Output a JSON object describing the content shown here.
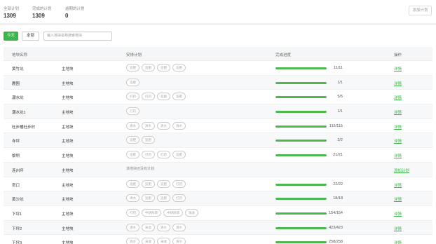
{
  "stats": [
    {
      "label": "全部计划",
      "value": "1309"
    },
    {
      "label": "完成的计划",
      "value": "1309"
    },
    {
      "label": "逾期的计划",
      "value": "0"
    }
  ],
  "plan_button": "添加计划",
  "toolbar": {
    "today": "今天",
    "all": "全部",
    "search_placeholder": "输入地块名称搜索地块"
  },
  "columns": {
    "name": "地块名称",
    "plan": "安排计划",
    "progress": "完成进度",
    "op": "操作"
  },
  "rows": [
    {
      "name": "黄竹坑",
      "type": "主地块",
      "tags": [
        "追肥",
        "追肥",
        "追肥",
        "追肥"
      ],
      "note": "",
      "progress": 1.0,
      "count": "11/11",
      "op": "详情"
    },
    {
      "name": "鹿囿",
      "type": "主地块",
      "tags": [
        "追肥"
      ],
      "note": "",
      "progress": 1.0,
      "count": "1/1",
      "op": "详情"
    },
    {
      "name": "潮水坑",
      "type": "主地块",
      "tags": [
        "打药",
        "打药",
        "追肥",
        "追肥"
      ],
      "note": "",
      "progress": 1.0,
      "count": "5/5",
      "op": "详情"
    },
    {
      "name": "潮水坑1",
      "type": "主地块",
      "tags": [
        "打药"
      ],
      "note": "",
      "progress": 1.0,
      "count": "1/1",
      "op": "详情"
    },
    {
      "name": "杜步桶杜步村",
      "type": "主地块",
      "tags": [
        "清水",
        "清水",
        "清水",
        "清水"
      ],
      "note": "",
      "progress": 1.0,
      "count": "115/115",
      "op": "详情"
    },
    {
      "name": "寺坪",
      "type": "主地块",
      "tags": [
        "追肥",
        "追肥"
      ],
      "note": "",
      "progress": 1.0,
      "count": "2/2",
      "op": "详情"
    },
    {
      "name": "黎垌",
      "type": "主地块",
      "tags": [
        "追肥",
        "打药",
        "打药",
        "追肥"
      ],
      "note": "",
      "progress": 1.0,
      "count": "21/21",
      "op": "详情"
    },
    {
      "name": "连州坪",
      "type": "主地块",
      "tags": [],
      "note": "该地块还没有计划",
      "progress": null,
      "count": "",
      "op": "添加计划"
    },
    {
      "name": "官口",
      "type": "主地块",
      "tags": [
        "追肥",
        "追肥",
        "追肥",
        "打药"
      ],
      "note": "",
      "progress": 1.0,
      "count": "22/22",
      "op": "详情"
    },
    {
      "name": "黄沙坑",
      "type": "主地块",
      "tags": [
        "清水",
        "追肥",
        "追肥",
        "打药"
      ],
      "note": "",
      "progress": 1.0,
      "count": "18/18",
      "op": "详情"
    },
    {
      "name": "下坪1",
      "type": "主地块",
      "tags": [
        "打药",
        "中耕除草",
        "中耕除草",
        "采收"
      ],
      "note": "",
      "progress": 1.0,
      "count": "154/154",
      "op": "详情"
    },
    {
      "name": "下坪2",
      "type": "主地块",
      "tags": [
        "清水",
        "采收",
        "清水",
        "清水"
      ],
      "note": "",
      "progress": 1.0,
      "count": "423/423",
      "op": "详情"
    },
    {
      "name": "下坪3",
      "type": "主地块",
      "tags": [
        "清水",
        "采收",
        "采收",
        "清水"
      ],
      "note": "",
      "progress": 1.0,
      "count": "258/258",
      "op": "详情"
    }
  ]
}
